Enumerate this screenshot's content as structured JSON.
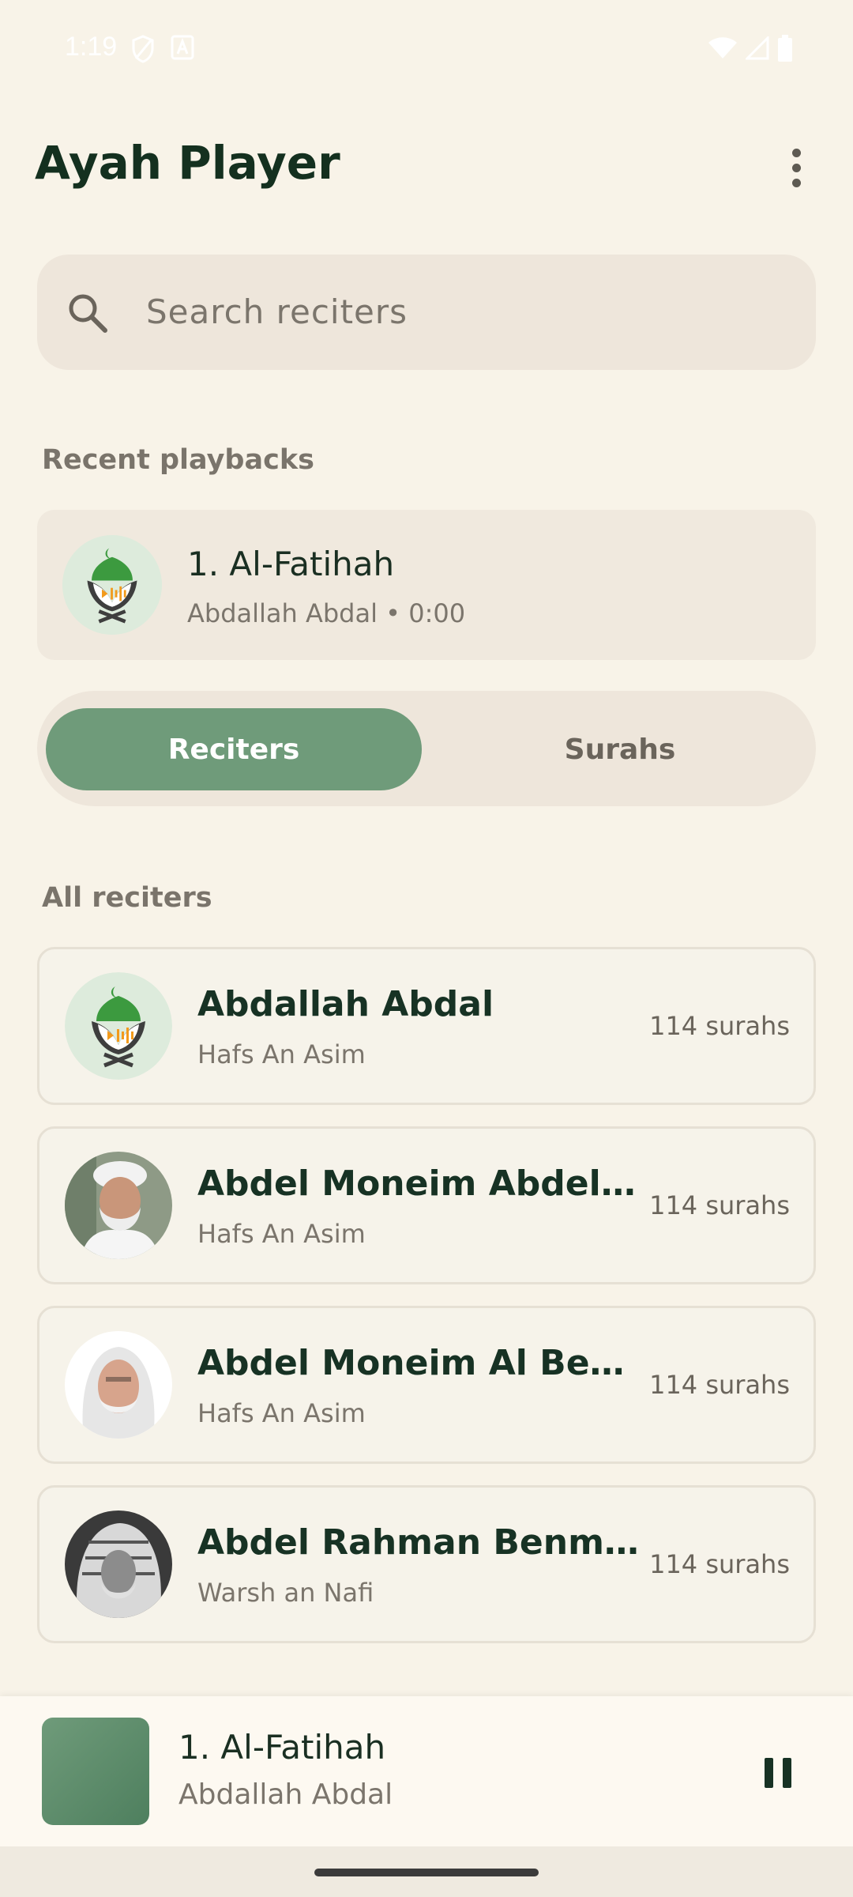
{
  "status_bar": {
    "time": "1:19"
  },
  "app": {
    "title": "Ayah Player"
  },
  "search": {
    "placeholder": "Search reciters"
  },
  "recent": {
    "section_label": "Recent playbacks",
    "item": {
      "title": "1. Al-Fatihah",
      "subtitle": "Abdallah Abdal • 0:00"
    }
  },
  "tabs": {
    "active": "Reciters",
    "inactive": "Surahs"
  },
  "reciters": {
    "section_label": "All reciters",
    "items": [
      {
        "name": "Abdallah Abdal",
        "rewayah": "Hafs An Asim",
        "count": "114 surahs",
        "avatar": "app-logo"
      },
      {
        "name": "Abdel Moneim Abdel Al Adl",
        "rewayah": "Hafs An Asim",
        "count": "114 surahs",
        "avatar": "photo"
      },
      {
        "name": "Abdel Moneim Al Behairy",
        "rewayah": "Hafs An Asim",
        "count": "114 surahs",
        "avatar": "photo"
      },
      {
        "name": "Abdel Rahman Benmoussa",
        "rewayah": "Warsh an Nafi",
        "count": "114 surahs",
        "avatar": "photo"
      }
    ]
  },
  "mini_player": {
    "title": "1. Al-Fatihah",
    "subtitle": "Abdallah Abdal"
  },
  "colors": {
    "accent": "#6F9B7A",
    "background": "#F8F3E8",
    "text_dark": "#14301F"
  }
}
